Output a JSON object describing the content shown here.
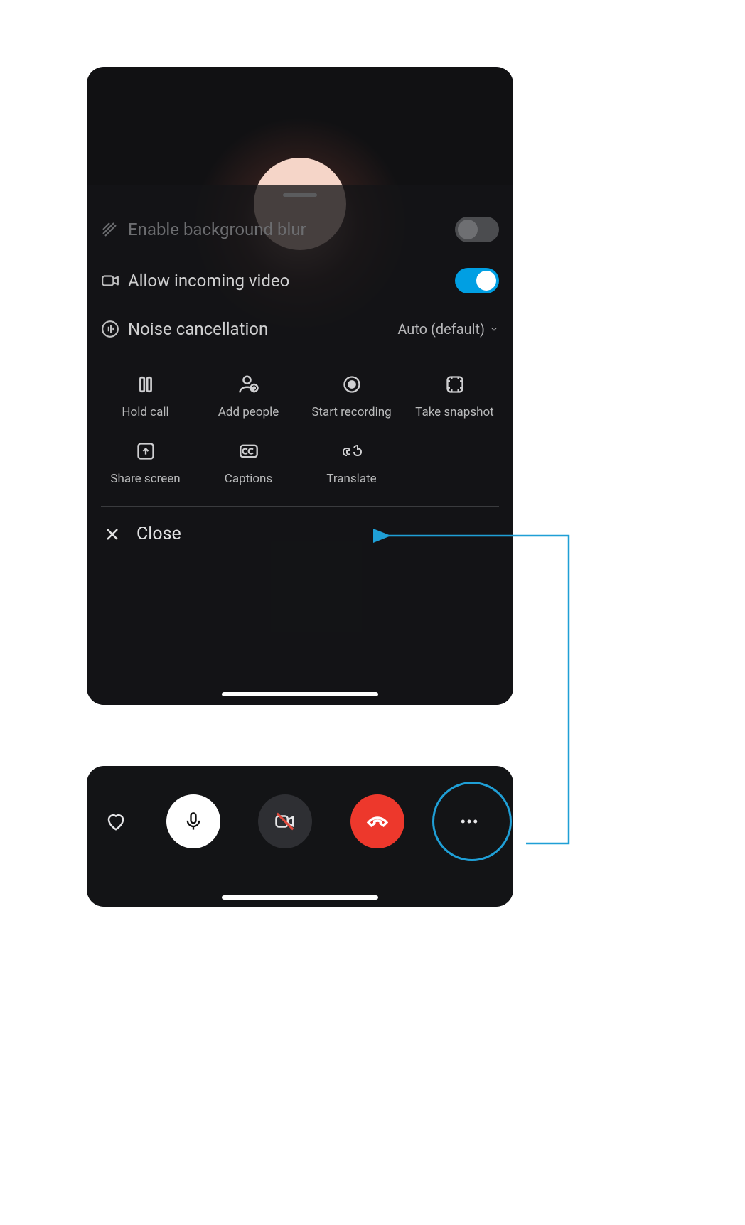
{
  "settings": {
    "blur": {
      "label": "Enable background blur",
      "on": false
    },
    "video": {
      "label": "Allow incoming video",
      "on": true
    },
    "noise": {
      "label": "Noise cancellation",
      "value": "Auto (default)"
    }
  },
  "actions": [
    {
      "id": "hold",
      "label": "Hold call"
    },
    {
      "id": "addpeople",
      "label": "Add people"
    },
    {
      "id": "record",
      "label": "Start recording"
    },
    {
      "id": "snapshot",
      "label": "Take snapshot"
    },
    {
      "id": "share",
      "label": "Share screen"
    },
    {
      "id": "captions",
      "label": "Captions"
    },
    {
      "id": "translate",
      "label": "Translate"
    }
  ],
  "close_label": "Close",
  "callbar": {
    "react": "heart",
    "mic": "on",
    "camera": "off",
    "hangup": "hangup",
    "more": "more"
  },
  "colors": {
    "accent": "#009fe3",
    "danger": "#ed382c",
    "annotation": "#1f9fd6"
  }
}
